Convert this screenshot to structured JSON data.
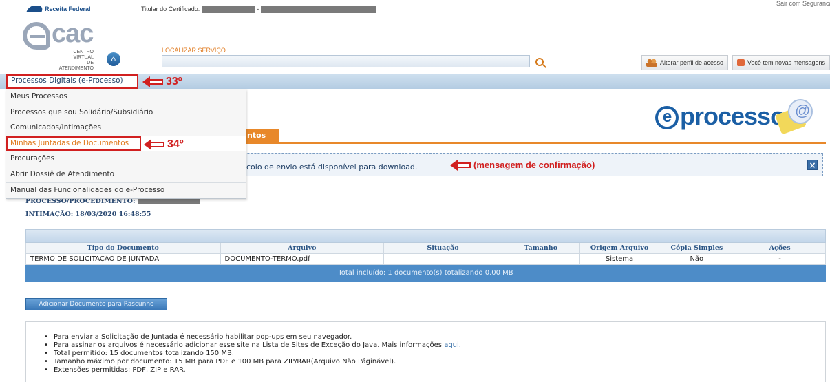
{
  "header": {
    "org_name": "Receita Federal",
    "certificate_label": "Titular do Certificado:",
    "certificate_sep": "-",
    "top_right_partial": "Sair com Seguranca",
    "ecac_word": "cac",
    "ecac_subtitle_line1": "CENTRO VIRTUAL",
    "ecac_subtitle_line2": "DE ATENDIMENTO",
    "search_label": "LOCALIZAR SERVIÇO",
    "search_value": "",
    "profile_button": "Alterar perfil de acesso",
    "messages_button": "Você tem novas mensagens"
  },
  "menu": {
    "title": "Processos Digitais (e-Processo)",
    "items": [
      "Meus Processos",
      "Processos que sou Solidário/Subsidiário",
      "Comunicados/Intimações",
      "Minhas Juntadas de Documentos",
      "Procurações",
      "Abrir Dossiê de Atendimento",
      "Manual das Funcionalidades do e-Processo"
    ],
    "active_index": 3
  },
  "annotations": {
    "step_33": "33º",
    "step_34": "34º",
    "confirmation": "(mensagem de confirmação)"
  },
  "logo": {
    "eprocesso_text": "processo"
  },
  "tab": {
    "partial_label": "ntos"
  },
  "message": {
    "text": "colo de envio está disponível para download.",
    "close_glyph": "×"
  },
  "process": {
    "label": "PROCESSO/PROCEDIMENTO:",
    "intimacao": "INTIMAÇÃO: 18/03/2020 16:48:55"
  },
  "table": {
    "headers": [
      "Tipo do Documento",
      "Arquivo",
      "Situação",
      "Tamanho",
      "Origem Arquivo",
      "Cópia Simples",
      "Ações"
    ],
    "rows": [
      [
        "TERMO DE SOLICITAÇÃO DE JUNTADA",
        "DOCUMENTO-TERMO.pdf",
        "",
        "",
        "Sistema",
        "Não",
        "-"
      ]
    ],
    "total": "Total incluído: 1 documento(s) totalizando 0.00 MB"
  },
  "actions": {
    "add_document": "Adicionar Documento para Rascunho"
  },
  "info": {
    "items": [
      "Para enviar a Solicitação de Juntada é necessário habilitar pop-ups em seu navegador.",
      "Para assinar os arquivos é necessário adicionar esse site na Lista de Sites de Exceção do Java. Mais informações ",
      "Total permitido: 15 documentos totalizando 150 MB.",
      "Tamanho máximo por documento: 15 MB para PDF e 100 MB para ZIP/RAR(Arquivo Não Páginável).",
      "Extensões permitidas: PDF, ZIP e RAR."
    ],
    "link_text": "aqui."
  },
  "colors": {
    "accent_orange": "#e8882a",
    "annotation_red": "#d12020",
    "brand_blue": "#1b5fa5",
    "table_total_blue": "#4d8cc8"
  }
}
